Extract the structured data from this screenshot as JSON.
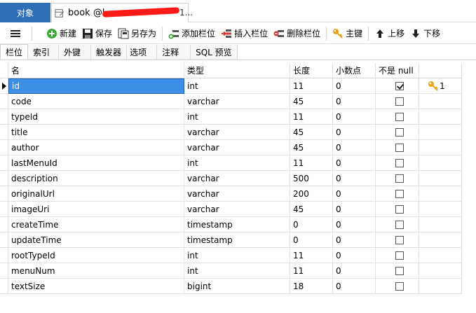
{
  "tabs": {
    "objects": "对象",
    "document_title": "book @l",
    "document_tail": "1..."
  },
  "toolbar": {
    "new": "新建",
    "save": "保存",
    "save_as": "另存为",
    "add_field": "添加栏位",
    "insert_field": "插入栏位",
    "delete_field": "删除栏位",
    "primary_key": "主键",
    "move_up": "上移",
    "move_down": "下移"
  },
  "subtabs": [
    "栏位",
    "索引",
    "外键",
    "触发器",
    "选项",
    "注释",
    "SQL 预览"
  ],
  "columns": [
    "名",
    "类型",
    "长度",
    "小数点",
    "不是 null",
    ""
  ],
  "rows": [
    {
      "name": "id",
      "type": "int",
      "length": "11",
      "decimals": "0",
      "not_null": true,
      "key": "1"
    },
    {
      "name": "code",
      "type": "varchar",
      "length": "45",
      "decimals": "0",
      "not_null": false,
      "key": ""
    },
    {
      "name": "typeId",
      "type": "int",
      "length": "11",
      "decimals": "0",
      "not_null": false,
      "key": ""
    },
    {
      "name": "title",
      "type": "varchar",
      "length": "45",
      "decimals": "0",
      "not_null": false,
      "key": ""
    },
    {
      "name": "author",
      "type": "varchar",
      "length": "45",
      "decimals": "0",
      "not_null": false,
      "key": ""
    },
    {
      "name": "lastMenuId",
      "type": "int",
      "length": "11",
      "decimals": "0",
      "not_null": false,
      "key": ""
    },
    {
      "name": "description",
      "type": "varchar",
      "length": "500",
      "decimals": "0",
      "not_null": false,
      "key": ""
    },
    {
      "name": "originalUrl",
      "type": "varchar",
      "length": "200",
      "decimals": "0",
      "not_null": false,
      "key": ""
    },
    {
      "name": "imageUri",
      "type": "varchar",
      "length": "45",
      "decimals": "0",
      "not_null": false,
      "key": ""
    },
    {
      "name": "createTime",
      "type": "timestamp",
      "length": "0",
      "decimals": "0",
      "not_null": false,
      "key": ""
    },
    {
      "name": "updateTime",
      "type": "timestamp",
      "length": "0",
      "decimals": "0",
      "not_null": false,
      "key": ""
    },
    {
      "name": "rootTypeId",
      "type": "int",
      "length": "11",
      "decimals": "0",
      "not_null": false,
      "key": ""
    },
    {
      "name": "menuNum",
      "type": "int",
      "length": "11",
      "decimals": "0",
      "not_null": false,
      "key": ""
    },
    {
      "name": "textSize",
      "type": "bigint",
      "length": "18",
      "decimals": "0",
      "not_null": false,
      "key": ""
    }
  ],
  "colors": {
    "tab_active": "#2e6fb7",
    "selection": "#3d8ee6",
    "redaction": "#ff1a1a",
    "key_icon": "#e8a317"
  },
  "icons": [
    "menu-icon",
    "new-icon",
    "save-icon",
    "save-as-icon",
    "add-field-icon",
    "insert-field-icon",
    "delete-field-icon",
    "key-icon",
    "arrow-up-icon",
    "arrow-down-icon",
    "row-pointer-icon",
    "primary-key-icon"
  ]
}
